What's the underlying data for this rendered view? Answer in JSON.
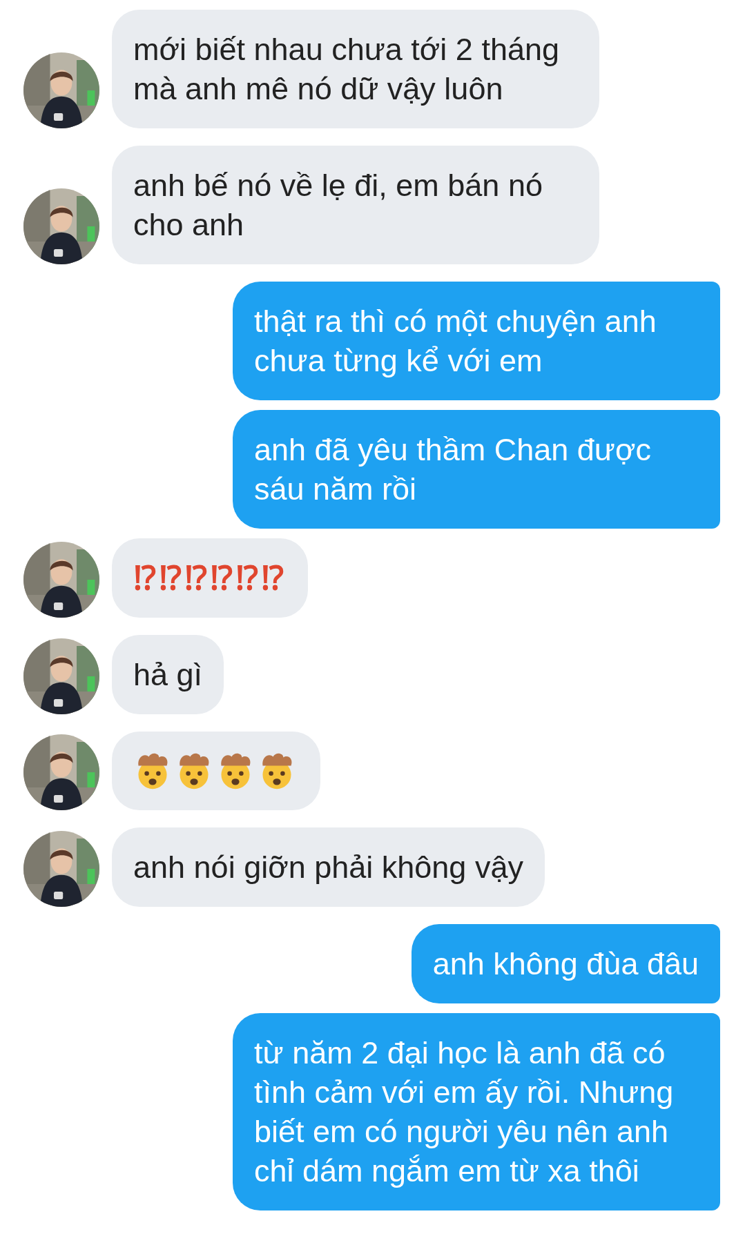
{
  "messages": [
    {
      "outgoing": false,
      "kind": "text",
      "text": "mới biết nhau chưa tới 2 tháng mà anh mê nó dữ vậy luôn"
    },
    {
      "outgoing": false,
      "kind": "text",
      "text": "anh bế nó về lẹ đi, em bán nó cho anh"
    },
    {
      "outgoing": true,
      "kind": "text",
      "text": "thật ra thì có một chuyện anh chưa từng kể với em"
    },
    {
      "outgoing": true,
      "kind": "text",
      "text": "anh đã yêu thầm Chan được sáu năm rồi"
    },
    {
      "outgoing": false,
      "kind": "symbols",
      "text": "⁉⁉⁉⁉⁉⁉"
    },
    {
      "outgoing": false,
      "kind": "text",
      "text": "hả gì"
    },
    {
      "outgoing": false,
      "kind": "icons",
      "icons": [
        {
          "kind": "exploding-head"
        },
        {
          "kind": "exploding-head"
        },
        {
          "kind": "exploding-head"
        },
        {
          "kind": "exploding-head"
        }
      ]
    },
    {
      "outgoing": false,
      "kind": "text",
      "text": "anh nói giỡn phải không vậy"
    },
    {
      "outgoing": true,
      "kind": "text",
      "text": "anh không đùa đâu"
    },
    {
      "outgoing": true,
      "kind": "text",
      "text": "từ năm 2 đại học là anh đã có tình cảm với em ấy rồi. Nhưng biết em có người yêu nên anh chỉ dám ngắm em từ xa thôi"
    }
  ]
}
